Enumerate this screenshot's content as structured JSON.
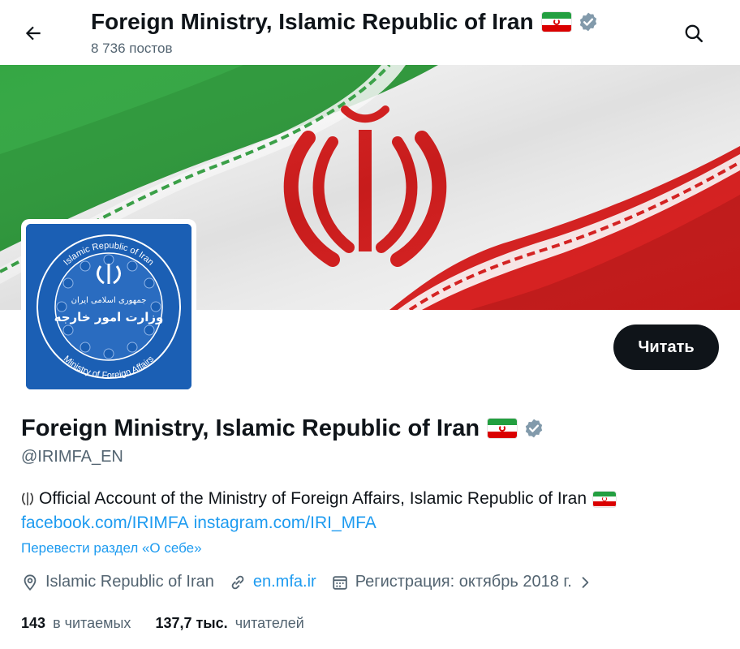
{
  "header": {
    "title": "Foreign Ministry, Islamic Republic of Iran",
    "posts_count": "8 736 постов",
    "back_icon": "arrow-left-icon",
    "search_icon": "search-icon"
  },
  "profile": {
    "name": "Foreign Ministry, Islamic Republic of Iran",
    "handle": "@IRIMFA_EN",
    "follow_label": "Читать",
    "avatar_text": {
      "arc_top": "Islamic Republic of Iran",
      "arc_bottom": "Ministry of Foreign Affairs",
      "persian_line1": "جمهوری اسلامی ایران",
      "persian_line2": "وزارت امور خارجه"
    },
    "bio_text": "Official Account of the Ministry of Foreign Affairs, Islamic Republic of Iran",
    "bio_links": [
      "facebook.com/IRIMFA",
      "instagram.com/IRI_MFA"
    ],
    "translate_label": "Перевести раздел «О себе»",
    "location": "Islamic Republic of Iran",
    "website": "en.mfa.ir",
    "joined": "Регистрация: октябрь 2018 г.",
    "following_count": "143",
    "following_label": "в читаемых",
    "followers_count": "137,7 тыс.",
    "followers_label": "читателей"
  },
  "colors": {
    "accent": "#1d9bf0",
    "text_primary": "#0f1419",
    "text_secondary": "#536471",
    "flag_green": "#239f40",
    "flag_red": "#da0000",
    "avatar_blue": "#1b5fb4",
    "verified_gray": "#829aab"
  }
}
